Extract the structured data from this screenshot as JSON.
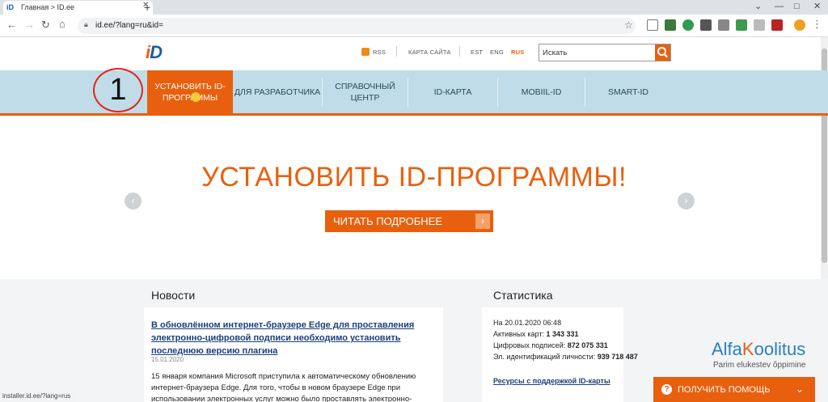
{
  "browser": {
    "tab_title": "Главная > ID.ee",
    "tab_favicon": "iD",
    "url": "id.ee/?lang=ru&id=",
    "status_url": "installer.id.ee/?lang=rus"
  },
  "site": {
    "logo_i": "i",
    "logo_d": "D",
    "top_links": {
      "rss": "RSS",
      "sitemap": "КАРТА САЙТА",
      "lang_est": "EST",
      "lang_eng": "ENG",
      "lang_rus": "RUS"
    },
    "search": {
      "placeholder": "Искать",
      "value": "Искать"
    },
    "nav": [
      {
        "label": "УСТАНОВИТЬ ID-ПРОГРАММЫ",
        "active": true
      },
      {
        "label": "ДЛЯ РАЗРАБОТЧИКА"
      },
      {
        "label": "СПРАВОЧНЫЙ ЦЕНТР"
      },
      {
        "label": "ID-КАРТА"
      },
      {
        "label": "MOBIIL-ID"
      },
      {
        "label": "SMART-ID"
      }
    ],
    "annotation_number": "1",
    "hero": {
      "title": "УСТАНОВИТЬ ID-ПРОГРАММЫ!",
      "button": "ЧИТАТЬ ПОДРОБНЕЕ",
      "button_arrow": "›",
      "prev": "‹",
      "next": "›"
    },
    "news": {
      "heading": "Новости",
      "link": "В обновлённом интернет-браузере Edge для проставления электронно-цифровой подписи необходимо установить последнюю версию плагина",
      "date": "15.01.2020",
      "text": "15 января компания Microsoft приступила к автоматическому обновлению интернет-браузера Edge. Для того, чтобы в новом браузере Edge при использовании электронных услуг можно было проставлять электронно-"
    },
    "stats": {
      "heading": "Статистика",
      "date_line": "На 20.01.2020 06:48",
      "active_label": "Активных карт: ",
      "active_value": "1 343 331",
      "signatures_label": "Цифровых подписей: ",
      "signatures_value": "872 075 331",
      "auth_label": "Эл. идентификаций личности: ",
      "auth_value": "939 718 487",
      "resources_link": "Ресурсы с поддержкой ID-карты"
    },
    "help_button": "ПОЛУЧИТЬ ПОМОЩЬ",
    "help_icon": "?",
    "help_chevron": "⌄"
  },
  "watermark": {
    "alfa": "Alfa",
    "koolitus_k": "K",
    "koolitus_rest": "oolitus",
    "subtitle": "Parim elukestev õppimine"
  },
  "colors": {
    "accent": "#e8600e",
    "nav_bg": "#bfdce8",
    "link": "#1c3f7a"
  }
}
